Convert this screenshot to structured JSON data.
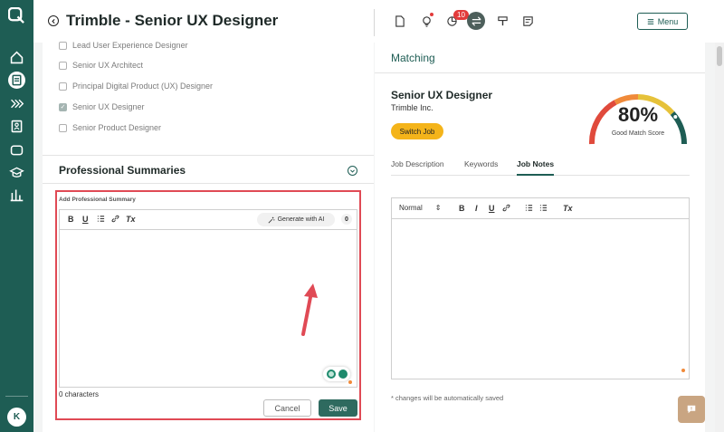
{
  "header": {
    "title": "Trimble - Senior UX Designer",
    "notification_count": "10",
    "menu_label": "Menu"
  },
  "job_titles": [
    {
      "label": "Lead User Experience Designer",
      "checked": false
    },
    {
      "label": "Senior UX Architect",
      "checked": false
    },
    {
      "label": "Principal Digital Product (UX) Designer",
      "checked": false
    },
    {
      "label": "Senior UX Designer",
      "checked": true
    },
    {
      "label": "Senior Product Designer",
      "checked": false
    }
  ],
  "summaries": {
    "section_title": "Professional Summaries",
    "field_label": "Add Professional Summary",
    "toolbar": {
      "bold": "B",
      "underline": "U",
      "clear_format": "Tx",
      "generate_ai": "Generate with AI",
      "badge_count": "0"
    },
    "char_count": "0 characters",
    "cancel_label": "Cancel",
    "save_label": "Save"
  },
  "matching": {
    "title": "Matching",
    "job_title": "Senior UX Designer",
    "company": "Trimble Inc.",
    "switch_label": "Switch Job",
    "score": "80%",
    "score_fraction": 0.8,
    "score_label": "Good Match Score",
    "tabs": [
      "Job Description",
      "Keywords",
      "Job Notes"
    ],
    "active_tab": "Job Notes",
    "notes_toolbar": {
      "format": "Normal",
      "bold": "B",
      "italic": "I",
      "underline": "U",
      "clear_format": "Tx"
    },
    "autosave_note": "* changes will be automatically saved"
  },
  "colors": {
    "brand": "#1e5d54",
    "highlight": "#e04a55",
    "accent": "#f4b41a"
  }
}
